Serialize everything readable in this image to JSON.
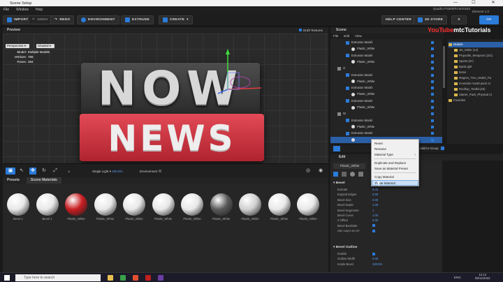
{
  "window": {
    "title": "Scene Setup",
    "minimize": "—",
    "maximize": "☐",
    "close": "✕"
  },
  "menu": {
    "items": [
      "File",
      "Window",
      "Help"
    ],
    "status_right": "Quadro P4000/PCIe/SSE2",
    "element_label": "Element 1.0"
  },
  "toolbar": {
    "import": "IMPORT",
    "undo": "UNDO",
    "redo": "REDO",
    "environment": "ENVIRONMENT",
    "extrude": "EXTRUDE",
    "create": "CREATE",
    "help_center": "HELP CENTER",
    "store": "3D STORE",
    "cancel": "X",
    "ok": "OK"
  },
  "preview": {
    "title": "Preview",
    "draft_textures": "Draft Textures",
    "view_mode": "Perspective",
    "shade_mode": "Shaded",
    "model_label": "Model:",
    "model_value": "Multiple Models",
    "vertices_label": "Vertices:",
    "vertices_value": "766",
    "faces_label": "Faces:",
    "faces_value": "284",
    "headline_top": "NOW",
    "headline_bottom": "NEWS",
    "light_label": "Single Light",
    "light_value": "100.0%",
    "environment_label": "Environment"
  },
  "materials": {
    "tabs": [
      "Presets",
      "Scene Materials"
    ],
    "items": [
      {
        "label": "Bevel 1",
        "color": "#e8e8e8"
      },
      {
        "label": "Bevel 1",
        "color": "#e8e8e8"
      },
      {
        "label": "Plastic_White",
        "color": "#c81e22"
      },
      {
        "label": "Plastic_White",
        "color": "#e8e8e8"
      },
      {
        "label": "Plastic_White",
        "color": "#e8e8e8"
      },
      {
        "label": "Plastic_White",
        "color": "#e8e8e8"
      },
      {
        "label": "Plastic_White",
        "color": "#e8e8e8"
      },
      {
        "label": "Plastic_White",
        "color": "#5a5a5a"
      },
      {
        "label": "Plastic_White",
        "color": "#d0d0d0"
      },
      {
        "label": "Plastic_White",
        "color": "#e8e8e8"
      },
      {
        "label": "Plastic_White",
        "color": "#e8e8e8"
      }
    ]
  },
  "scene": {
    "title": "Scene",
    "menu": [
      "File",
      "Edit",
      "View"
    ],
    "rows": [
      {
        "label": "Extrusion Model",
        "indent": 30,
        "kind": "model"
      },
      {
        "label": "Plastic_White",
        "indent": 38,
        "kind": "mat"
      },
      {
        "label": "Extrusion Model",
        "indent": 30,
        "kind": "model"
      },
      {
        "label": "Plastic_White",
        "indent": 38,
        "kind": "mat"
      },
      {
        "label": "O",
        "indent": 18,
        "kind": "group"
      },
      {
        "label": "Extrusion Model",
        "indent": 30,
        "kind": "model"
      },
      {
        "label": "Plastic_White",
        "indent": 38,
        "kind": "mat"
      },
      {
        "label": "Extrusion Model",
        "indent": 30,
        "kind": "model"
      },
      {
        "label": "Plastic_White",
        "indent": 38,
        "kind": "mat"
      },
      {
        "label": "Extrusion Model",
        "indent": 30,
        "kind": "model"
      },
      {
        "label": "Plastic_White",
        "indent": 38,
        "kind": "mat"
      },
      {
        "label": "W",
        "indent": 18,
        "kind": "group"
      },
      {
        "label": "Extrusion Model",
        "indent": 30,
        "kind": "model"
      },
      {
        "label": "Plastic_White",
        "indent": 38,
        "kind": "mat"
      },
      {
        "label": "Extrusion Model",
        "indent": 30,
        "kind": "model"
      },
      {
        "label": "",
        "indent": 38,
        "kind": "mat",
        "selected": true
      }
    ],
    "add_to_group": "Add to Group"
  },
  "branding": {
    "prefix": "YouTube",
    "suffix": "mtcTutorials"
  },
  "library": {
    "rows": [
      {
        "label": "Models",
        "indent": 2,
        "selected": true
      },
      {
        "label": "Jet_Strike (14)",
        "indent": 10
      },
      {
        "label": "Projectile_Weapons (101)",
        "indent": 10
      },
      {
        "label": "Sports (67)",
        "indent": 10
      },
      {
        "label": "BackLight",
        "indent": 10
      },
      {
        "label": "Items",
        "indent": 10
      },
      {
        "label": "Magnet_Tree_Model_Pa",
        "indent": 10
      },
      {
        "label": "mountain model pack v1",
        "indent": 10
      },
      {
        "label": "Rooftop_Toolkit (20)",
        "indent": 10
      },
      {
        "label": "Starter_Pack_Physical (4",
        "indent": 10
      },
      {
        "label": "Favorites",
        "indent": 2
      }
    ]
  },
  "context_menu": {
    "items": [
      "Reset",
      "Rename",
      "Material Type",
      "Duplicate and Replace",
      "Save as Material Preset",
      "Copy Material",
      "Paste Material"
    ],
    "submenu_arrow": "›"
  },
  "edit": {
    "title": "Edit",
    "material_name": "Plastic_White",
    "bevel_section": "Bevel",
    "props": [
      {
        "label": "Extrude",
        "value": "8.00"
      },
      {
        "label": "Expand Edges",
        "value": "0.00"
      },
      {
        "label": "Bevel Size",
        "value": "0.00"
      },
      {
        "label": "Bevel Depth",
        "value": "1.00"
      },
      {
        "label": "Bevel Segments",
        "value": "1"
      },
      {
        "label": "Bevel Curve",
        "value": "1.00"
      },
      {
        "label": "Z Offset",
        "value": "0.00"
      },
      {
        "label": "Bevel Backside",
        "value": ""
      },
      {
        "label": "Use Layer as UV",
        "value": ""
      }
    ],
    "outline_section": "Bevel Outline",
    "outline_props": [
      {
        "label": "Enable",
        "value": ""
      },
      {
        "label": "Outline Width",
        "value": "0.00"
      },
      {
        "label": "Inside Bevel",
        "value": "100.0%"
      }
    ]
  },
  "taskbar": {
    "search": "Type here to search",
    "lang": "ENG",
    "time": "12:14",
    "date": "08/12/2022"
  }
}
